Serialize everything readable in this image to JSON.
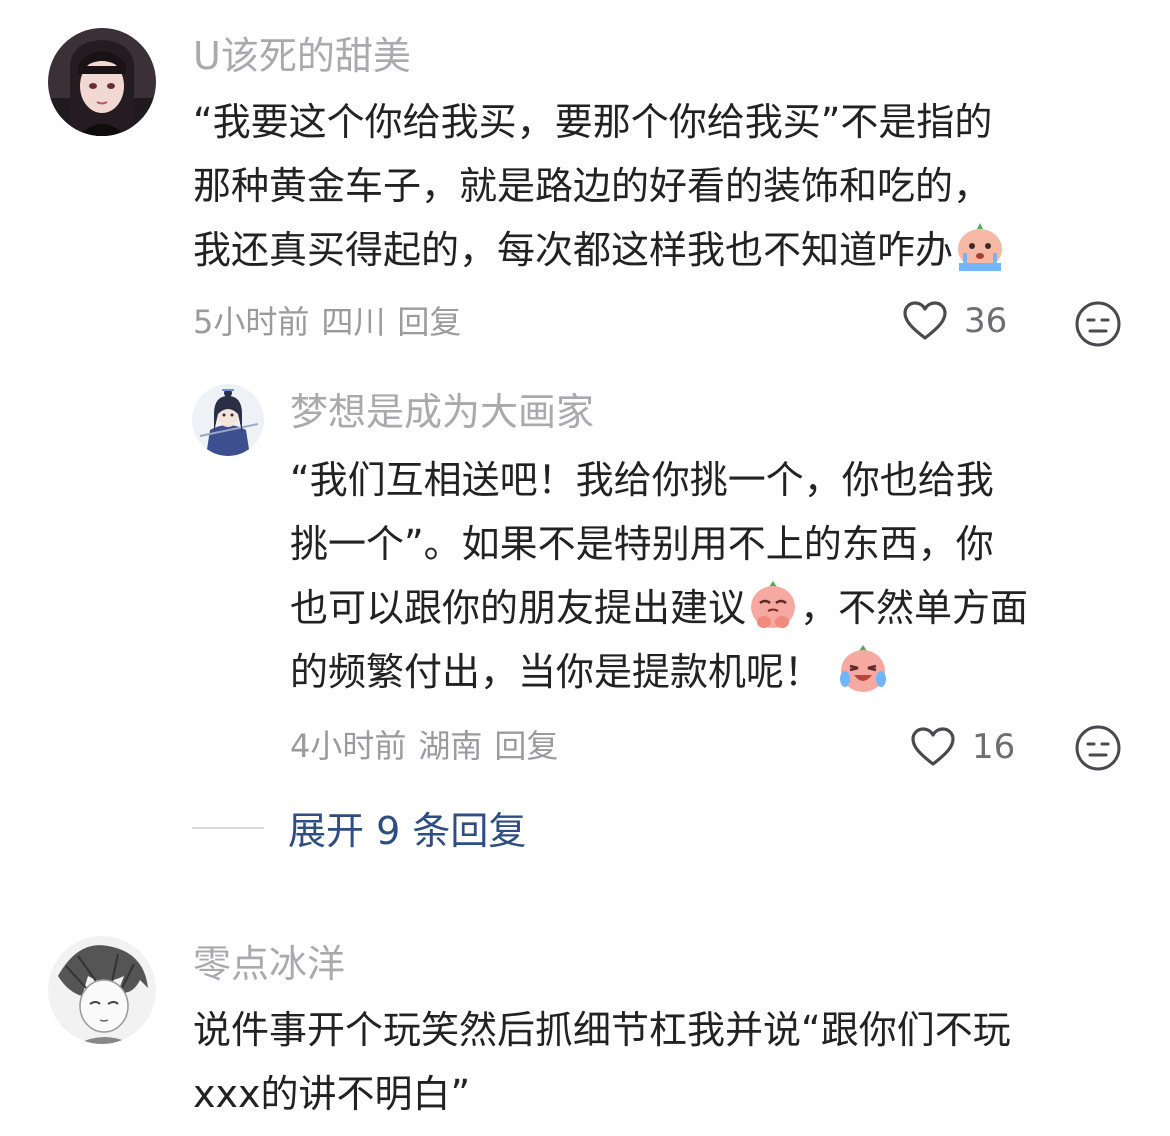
{
  "comments": [
    {
      "username": "U该死的甜美",
      "lines": [
        "“我要这个你给我买，要那个你给我买”不是指的",
        "那种黄金车子，就是路边的好看的装饰和吃的，",
        "我还真买得起的，每次都这样我也不知道咋办"
      ],
      "time": "5小时前",
      "location": "四川",
      "reply_label": "回复",
      "likes": "36"
    },
    {
      "username": "梦想是成为大画家",
      "lines": [
        "“我们互相送吧！我给你挑一个，你也给我",
        "挑一个”。如果不是特别用不上的东西，你",
        "也可以跟你的朋友提出建议",
        "，不然单方面",
        "的频繁付出，当你是提款机呢！"
      ],
      "time": "4小时前",
      "location": "湖南",
      "reply_label": "回复",
      "likes": "16"
    },
    {
      "username": "零点冰洋",
      "lines": [
        "说件事开个玩笑然后抓细节杠我并说“跟你们不玩",
        "xxx的讲不明白”"
      ]
    }
  ],
  "expand_replies": "展开 9 条回复",
  "icons": {
    "like": "heart-outline-icon",
    "dislike": "neutral-face-icon",
    "emoji_cry": "crying-emoji-icon",
    "emoji_pray": "pleading-emoji-icon",
    "emoji_laugh": "laugh-cry-emoji-icon"
  },
  "colors": {
    "username": "#a9a9ae",
    "text": "#222222",
    "meta": "#9a9a9f",
    "expand_link": "#2e4d80"
  }
}
